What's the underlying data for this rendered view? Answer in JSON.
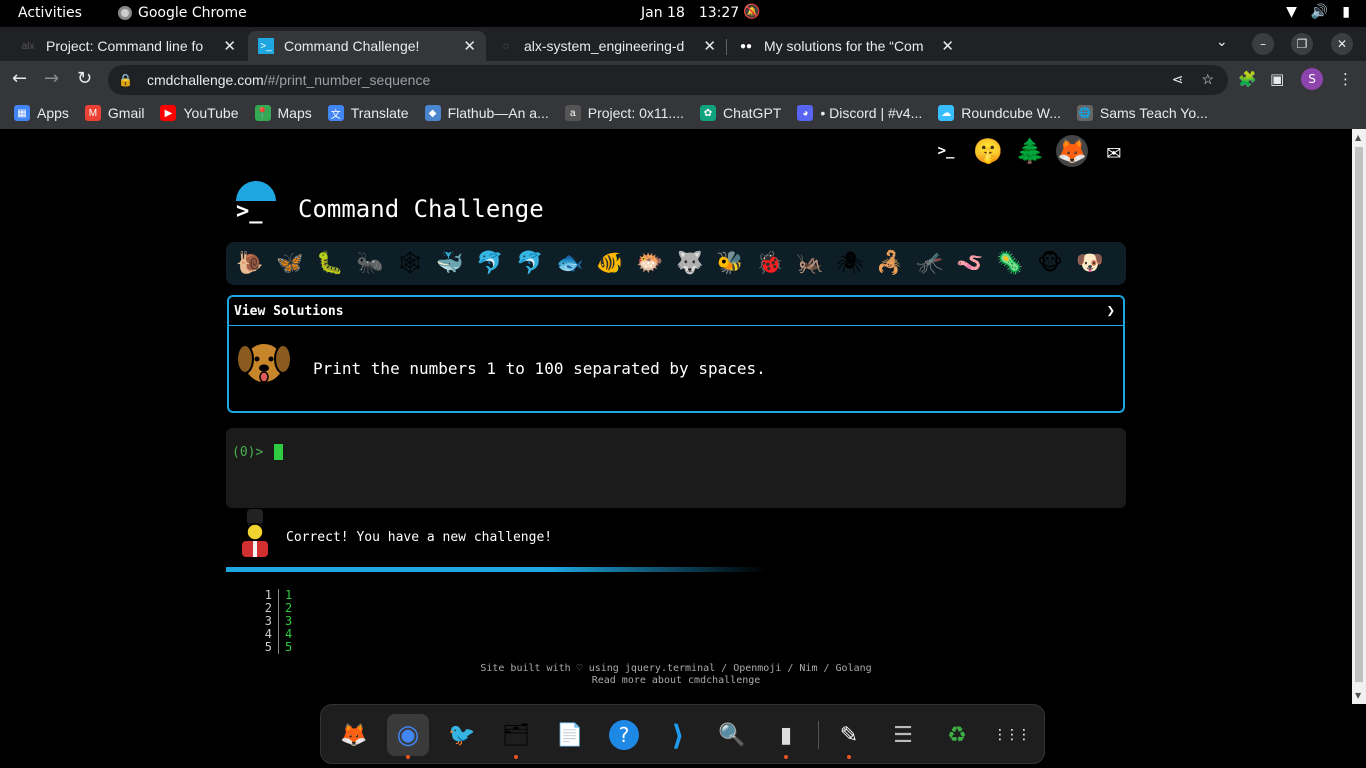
{
  "topbar": {
    "activities": "Activities",
    "app": "Google Chrome",
    "date": "Jan 18",
    "time": "13:27"
  },
  "tabs": [
    {
      "title": "Project: Command line fo",
      "active": false
    },
    {
      "title": "Command Challenge!",
      "active": true
    },
    {
      "title": "alx-system_engineering-d",
      "active": false
    },
    {
      "title": "My solutions for the “Com",
      "active": false
    }
  ],
  "omnibox": {
    "host": "cmdchallenge.com",
    "path": "/#/print_number_sequence"
  },
  "profile_initial": "S",
  "bookmarks": [
    {
      "label": "Apps",
      "icon": "apps-grid-icon",
      "color": "#4285f4"
    },
    {
      "label": "Gmail",
      "icon": "gmail-icon",
      "color": "#ea4335"
    },
    {
      "label": "YouTube",
      "icon": "youtube-icon",
      "color": "#ff0000"
    },
    {
      "label": "Maps",
      "icon": "maps-icon",
      "color": "#34a853"
    },
    {
      "label": "Translate",
      "icon": "translate-icon",
      "color": "#4285f4"
    },
    {
      "label": "Flathub—An a...",
      "icon": "flathub-icon",
      "color": "#4a86cf"
    },
    {
      "label": "Project: 0x11....",
      "icon": "alx-icon",
      "color": "#555555"
    },
    {
      "label": "ChatGPT",
      "icon": "chatgpt-icon",
      "color": "#10a37f"
    },
    {
      "label": "• Discord | #v4...",
      "icon": "discord-icon",
      "color": "#5865f2"
    },
    {
      "label": "Roundcube W...",
      "icon": "roundcube-icon",
      "color": "#37beff"
    },
    {
      "label": "Sams Teach Yo...",
      "icon": "globe-icon",
      "color": "#666666"
    }
  ],
  "page": {
    "heading": "Command Challenge",
    "animals": [
      "🐌",
      "🦋",
      "🐛",
      "🐜",
      "🕸",
      "🐳",
      "🐬",
      "🐬",
      "🐟",
      "🐠",
      "🐡",
      "🐺",
      "🐝",
      "🐞",
      "🦗",
      "🕷",
      "🦂",
      "🦟",
      "🪱",
      "🦠",
      "🐵",
      "🐶"
    ],
    "view_solutions": "View Solutions",
    "chevron": "❯",
    "task": "Print the numbers 1 to 100 separated by spaces.",
    "prompt": "(0)>",
    "correct": "Correct! You have a new challenge!",
    "output_lines": [
      {
        "n": "1",
        "v": "1"
      },
      {
        "n": "2",
        "v": "2"
      },
      {
        "n": "3",
        "v": "3"
      },
      {
        "n": "4",
        "v": "4"
      },
      {
        "n": "5",
        "v": "5"
      }
    ],
    "footer_line1": "Site built with ♡ using jquery.terminal / Openmoji / Nim / Golang",
    "footer_line2": "Read more about cmdchallenge"
  },
  "dock": [
    {
      "name": "firefox-icon",
      "glyph": "🦊"
    },
    {
      "name": "chrome-icon",
      "glyph": "◉"
    },
    {
      "name": "thunderbird-icon",
      "glyph": "🐦"
    },
    {
      "name": "files-icon",
      "glyph": "🗂"
    },
    {
      "name": "writer-icon",
      "glyph": "📄"
    },
    {
      "name": "help-icon",
      "glyph": "?"
    },
    {
      "name": "vscode-icon",
      "glyph": "⟩"
    },
    {
      "name": "screenshot-icon",
      "glyph": "🔍"
    },
    {
      "name": "terminal-icon",
      "glyph": "▮"
    },
    {
      "name": "text-editor-icon",
      "glyph": "✎"
    },
    {
      "name": "notes-icon",
      "glyph": "☰"
    },
    {
      "name": "trash-icon",
      "glyph": "♻"
    },
    {
      "name": "show-apps-icon",
      "glyph": "⋮⋮⋮"
    }
  ]
}
